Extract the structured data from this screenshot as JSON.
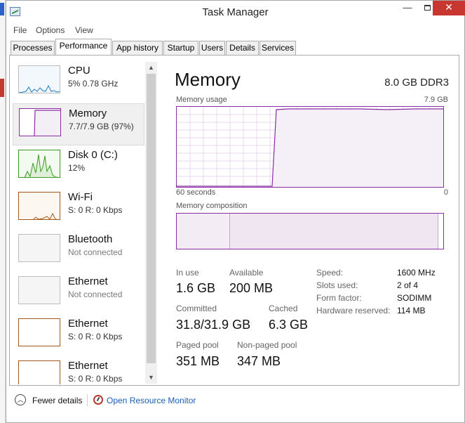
{
  "window": {
    "title": "Task Manager",
    "close_glyph": "✕",
    "minimize_glyph": "—"
  },
  "menu": [
    "File",
    "Options",
    "View"
  ],
  "tabs": [
    "Processes",
    "Performance",
    "App history",
    "Startup",
    "Users",
    "Details",
    "Services"
  ],
  "active_tab": "Performance",
  "resources": [
    {
      "name": "CPU",
      "sub": "5%  0.78 GHz",
      "color": "#1e7bc0",
      "fill": "#f3f8fc"
    },
    {
      "name": "Memory",
      "sub": "7.7/7.9 GB (97%)",
      "color": "#8b2da2",
      "fill": "#f4eef6"
    },
    {
      "name": "Disk 0 (C:)",
      "sub": "12%",
      "color": "#3a9a24",
      "fill": "#f3faf0"
    },
    {
      "name": "Wi-Fi",
      "sub": "S: 0  R: 0 Kbps",
      "color": "#a8571a",
      "fill": "#fdf7f1"
    },
    {
      "name": "Bluetooth",
      "sub": "Not connected",
      "color": "#bdbdbd",
      "fill": "#f5f5f5"
    },
    {
      "name": "Ethernet",
      "sub": "Not connected",
      "color": "#bdbdbd",
      "fill": "#f5f5f5"
    },
    {
      "name": "Ethernet",
      "sub": "S: 0  R: 0 Kbps",
      "color": "#a8571a",
      "fill": "#ffffff"
    },
    {
      "name": "Ethernet",
      "sub": "S: 0  R: 0 Kbps",
      "color": "#a8571a",
      "fill": "#ffffff"
    }
  ],
  "selected_resource": "Memory",
  "detail": {
    "title": "Memory",
    "spec": "8.0 GB DDR3",
    "usage_label": "Memory usage",
    "usage_max": "7.9 GB",
    "axis_left": "60 seconds",
    "axis_right": "0",
    "composition_label": "Memory composition",
    "in_use_label": "In use",
    "in_use_value": "1.6 GB",
    "available_label": "Available",
    "available_value": "200 MB",
    "committed_label": "Committed",
    "committed_value": "31.8/31.9 GB",
    "cached_label": "Cached",
    "cached_value": "6.3 GB",
    "paged_label": "Paged pool",
    "paged_value": "351 MB",
    "nonpaged_label": "Non-paged pool",
    "nonpaged_value": "347 MB",
    "speed_label": "Speed:",
    "speed_value": "1600 MHz",
    "slots_label": "Slots used:",
    "slots_value": "2 of 4",
    "form_label": "Form factor:",
    "form_value": "SODIMM",
    "reserved_label": "Hardware reserved:",
    "reserved_value": "114 MB"
  },
  "footer": {
    "fewer_details": "Fewer details",
    "open_monitor": "Open Resource Monitor"
  },
  "colors": {
    "memory": "#8b2da2",
    "link": "#1a5fb4",
    "close": "#c7372f"
  }
}
